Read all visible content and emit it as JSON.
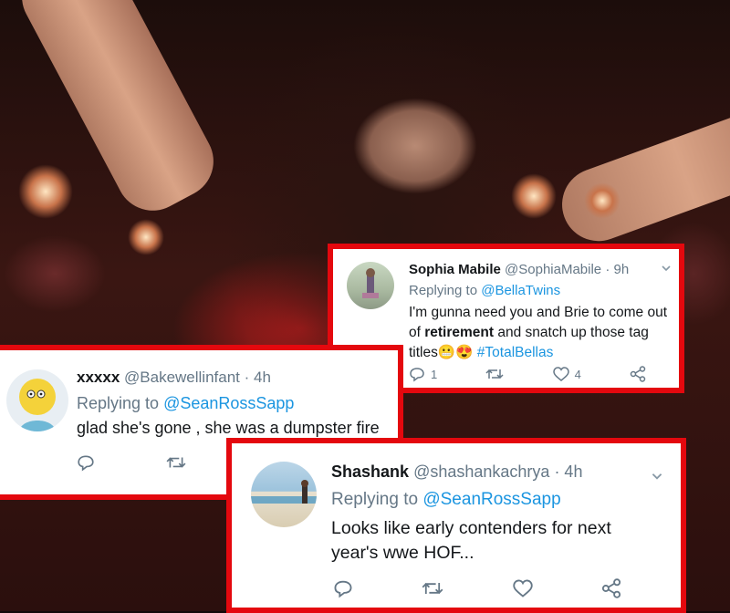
{
  "tweets": [
    {
      "name": "Sophia Mabile",
      "handle": "@SophiaMabile",
      "time": "· 9h",
      "replying_prefix": "Replying to",
      "replying_to": "@BellaTwins",
      "text_line1": "I'm gunna need you and Brie to come out",
      "text_line2_pre": "of ",
      "text_line2_bold": "retirement",
      "text_line2_post": " and snatch up those tag",
      "text_line3": "titles",
      "emoji": "😬😍",
      "hashtag": "#TotalBellas",
      "replies": "1",
      "likes": "4"
    },
    {
      "name": "xxxxx",
      "handle": "@Bakewellinfant",
      "time": "· 4h",
      "replying_prefix": "Replying to",
      "replying_to": "@SeanRossSapp",
      "text": "glad she's gone , she was a dumpster fire"
    },
    {
      "name": "Shashank",
      "handle": "@shashankachrya",
      "time": "· 4h",
      "replying_prefix": "Replying to",
      "replying_to": "@SeanRossSapp",
      "text_line1": "Looks like early contenders for next",
      "text_line2": "year's wwe HOF..."
    }
  ],
  "colors": {
    "highlight_border": "#e4080e",
    "link": "#1b95e0",
    "muted": "#657786"
  },
  "icons": [
    "reply-icon",
    "retweet-icon",
    "like-icon",
    "share-icon",
    "chevron-down-icon"
  ]
}
